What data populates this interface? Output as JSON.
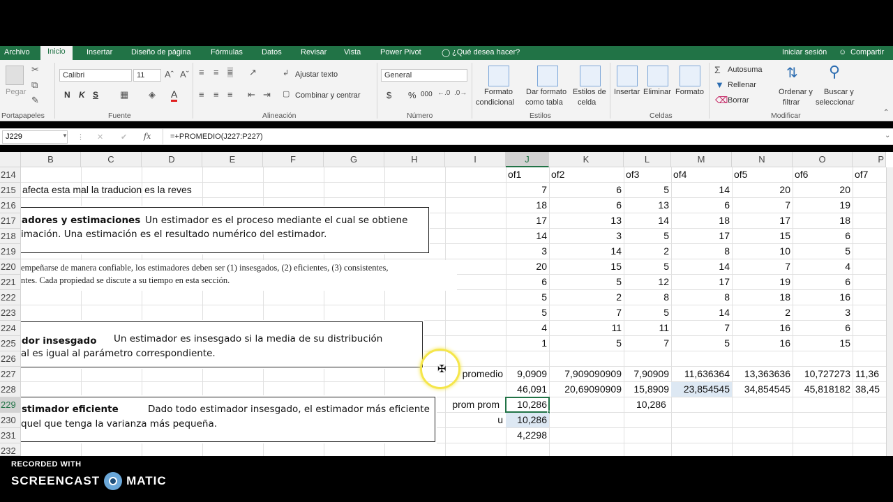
{
  "ribbon_tabs": [
    "Archivo",
    "Inicio",
    "Insertar",
    "Diseño de página",
    "Fórmulas",
    "Datos",
    "Revisar",
    "Vista",
    "Power Pivot",
    "¿Qué desea hacer?"
  ],
  "account": {
    "signin": "Iniciar sesión",
    "share": "Compartir"
  },
  "clipboard": {
    "paste": "Pegar",
    "group": "Portapapeles"
  },
  "font": {
    "name": "Calibri",
    "size": "11",
    "bold": "N",
    "italic": "K",
    "underline": "S",
    "group": "Fuente"
  },
  "alignment": {
    "wrap": "Ajustar texto",
    "merge": "Combinar y centrar",
    "group": "Alineación"
  },
  "number": {
    "format": "General",
    "currency": "$",
    "percent": "%",
    "thousands": "000",
    "group": "Número"
  },
  "styles": {
    "cond_format_1": "Formato",
    "cond_format_2": "condicional",
    "table_format_1": "Dar formato",
    "table_format_2": "como tabla",
    "cell_styles_1": "Estilos de",
    "cell_styles_2": "celda",
    "group": "Estilos"
  },
  "cells": {
    "insert": "Insertar",
    "delete": "Eliminar",
    "format": "Formato",
    "group": "Celdas"
  },
  "editing": {
    "autosum": "Autosuma",
    "fill": "Rellenar",
    "clear": "Borrar",
    "sort_1": "Ordenar y",
    "sort_2": "filtrar",
    "find_1": "Buscar y",
    "find_2": "seleccionar",
    "group": "Modificar"
  },
  "formula_bar": {
    "namebox": "J229",
    "cancel": "✕",
    "enter": "✔",
    "fx": "fx",
    "formula": "=+PROMEDIO(J227:P227)"
  },
  "columns": [
    "B",
    "C",
    "D",
    "E",
    "F",
    "G",
    "H",
    "I",
    "J",
    "K",
    "L",
    "M",
    "N",
    "O",
    "P"
  ],
  "rows": [
    "214",
    "215",
    "216",
    "217",
    "218",
    "219",
    "220",
    "221",
    "222",
    "223",
    "224",
    "225",
    "226",
    "227",
    "228",
    "229",
    "230",
    "231",
    "232"
  ],
  "text_cells": {
    "r215_b": "afecta esta mal la traducion es la reves",
    "r227_i": "promedio",
    "r229_i": "prom prom",
    "r230_i": "u"
  },
  "header_row": [
    "of1",
    "of2",
    "of3",
    "of4",
    "of5",
    "of6",
    "of7"
  ],
  "data_rows": [
    [
      "7",
      "6",
      "5",
      "14",
      "20",
      "20"
    ],
    [
      "18",
      "6",
      "13",
      "6",
      "7",
      "19"
    ],
    [
      "17",
      "13",
      "14",
      "18",
      "17",
      "18"
    ],
    [
      "14",
      "3",
      "5",
      "17",
      "15",
      "6"
    ],
    [
      "3",
      "14",
      "2",
      "8",
      "10",
      "5"
    ],
    [
      "20",
      "15",
      "5",
      "14",
      "7",
      "4"
    ],
    [
      "6",
      "5",
      "12",
      "17",
      "19",
      "6"
    ],
    [
      "5",
      "2",
      "8",
      "8",
      "18",
      "16"
    ],
    [
      "5",
      "7",
      "5",
      "14",
      "2",
      "3"
    ],
    [
      "4",
      "11",
      "11",
      "7",
      "16",
      "6"
    ],
    [
      "1",
      "5",
      "7",
      "5",
      "16",
      "15"
    ]
  ],
  "row227": [
    "9,0909",
    "7,909090909",
    "7,90909",
    "11,636364",
    "13,363636",
    "10,727273",
    "11,36"
  ],
  "row228": [
    "46,091",
    "20,69090909",
    "15,8909",
    "23,854545",
    "34,854545",
    "45,818182",
    "38,45"
  ],
  "row229": {
    "j": "10,286",
    "l": "10,286"
  },
  "row230": {
    "j": "10,286"
  },
  "row231": {
    "j": "4,2298"
  },
  "image1": {
    "title": "adores y estimaciones",
    "line1": "Un estimador es el proceso mediante el cual se obtiene",
    "line2": "imación. Una estimación es el resultado numérico del estimador."
  },
  "image2": {
    "line1": "empeñarse de manera confiable, los estimadores deben ser (1) insesgados, (2) eficientes, (3) consistentes,",
    "line2": "ntes. Cada propiedad se discute a su tiempo en esta sección."
  },
  "image3": {
    "title": "dor insesgado",
    "line1": "Un estimador es insesgado si la media de su distribución",
    "line2": "al es igual al parámetro correspondiente."
  },
  "image4": {
    "title": "stimador eficiente",
    "line1": "Dado todo estimador insesgado, el estimador más eficiente",
    "line2": "quel que tenga la varianza más pequeña."
  },
  "watermark": {
    "recorded": "RECORDED WITH",
    "brand1": "SCREENCAST",
    "brand2": "MATIC"
  },
  "colors": {
    "excel_green": "#217346",
    "selection": "#dde8f3",
    "cursor_ring": "#f5e64a"
  }
}
